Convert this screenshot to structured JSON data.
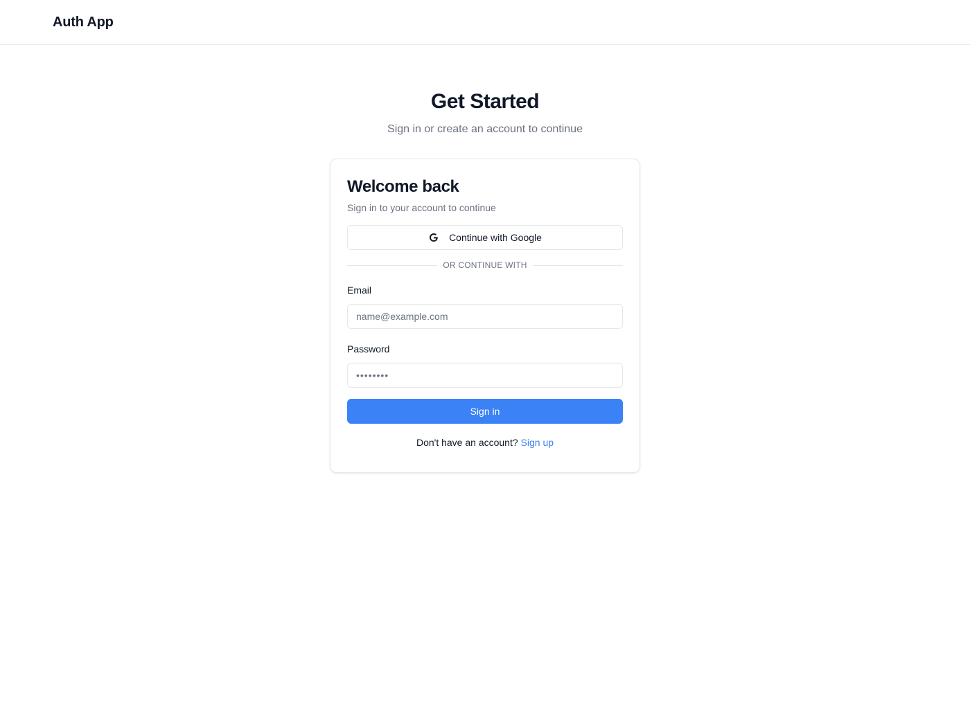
{
  "header": {
    "brand": "Auth App"
  },
  "hero": {
    "title": "Get Started",
    "subtitle": "Sign in or create an account to continue"
  },
  "card": {
    "title": "Welcome back",
    "subtitle": "Sign in to your account to continue",
    "google_button_label": "Continue with Google",
    "divider_text": "OR CONTINUE WITH",
    "email": {
      "label": "Email",
      "placeholder": "name@example.com",
      "value": ""
    },
    "password": {
      "label": "Password",
      "value": "••••••••"
    },
    "signin_button_label": "Sign in",
    "footer": {
      "prompt": "Don't have an account?",
      "link_label": "Sign up"
    }
  },
  "colors": {
    "accent": "#3b82f6",
    "text": "#111827",
    "muted": "#6b7280",
    "border": "#e5e7eb"
  },
  "icons": {
    "google": "google-icon"
  }
}
